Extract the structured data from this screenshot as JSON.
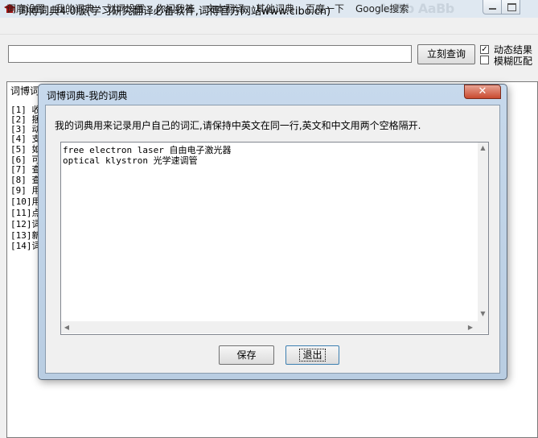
{
  "window": {
    "title": "词博词典4.0版(学习研究翻译必备软件,词博官方网站www.cibo.cn)",
    "title_deco": "AaBb AaBb",
    "icon": "graduation-cap-icon"
  },
  "menu": [
    "词库设置",
    "我的词典",
    "划词设置",
    "你问我答",
    "文本翻译",
    "其他词典",
    "百度一下",
    "Google搜索"
  ],
  "search": {
    "value": "",
    "query_button": "立刻查询",
    "dynamic_result_label": "动态结果",
    "dynamic_result_checked": true,
    "fuzzy_match_label": "模糊匹配",
    "fuzzy_match_checked": false
  },
  "results": {
    "title_visible": "词博词",
    "lines": [
      "[1] 收",
      "[2] 捆",
      "[3] 动",
      "[4] 支",
      "[5] 如",
      "[6] 可",
      "[7] 查",
      "[8] 查",
      "[9] 用",
      "[10]用",
      "[11]点",
      "[12]词",
      "[13]新",
      "[14]词"
    ]
  },
  "dialog": {
    "title": "词博词典-我的词典",
    "close_glyph": "✕",
    "description": "我的词典用来记录用户自己的词汇,请保持中英文在同一行,英文和中文用两个空格隔开.",
    "entries": [
      "free electron laser  自由电子激光器",
      "optical klystron  光学速调管"
    ],
    "save_button": "保存",
    "exit_button": "退出"
  }
}
